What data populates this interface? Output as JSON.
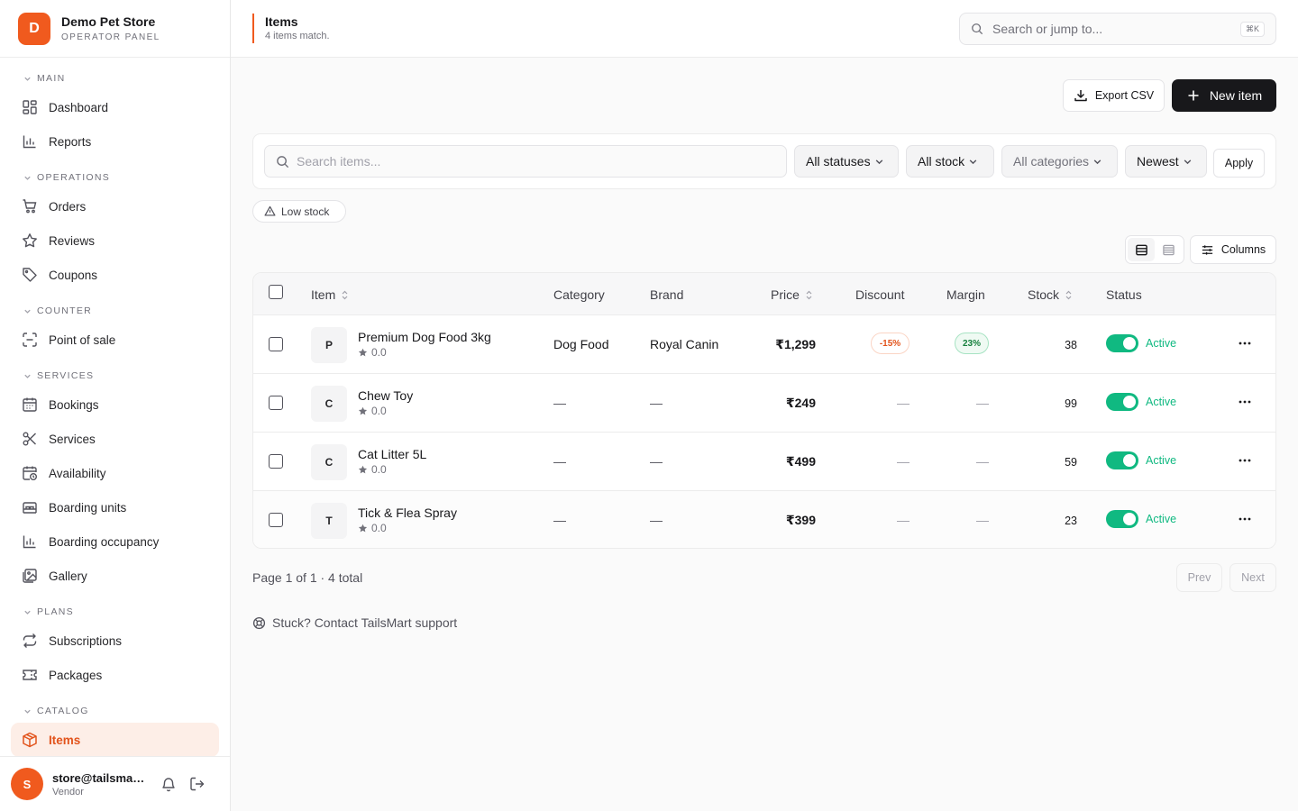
{
  "brand": {
    "initial": "D",
    "name": "Demo Pet Store",
    "subtitle": "OPERATOR PANEL"
  },
  "sidebar": {
    "sections": [
      {
        "title": "MAIN",
        "items": [
          {
            "label": "Dashboard",
            "icon": "grid-icon"
          },
          {
            "label": "Reports",
            "icon": "bar-chart-icon"
          }
        ]
      },
      {
        "title": "OPERATIONS",
        "items": [
          {
            "label": "Orders",
            "icon": "cart-icon"
          },
          {
            "label": "Reviews",
            "icon": "star-icon"
          },
          {
            "label": "Coupons",
            "icon": "tag-icon"
          }
        ]
      },
      {
        "title": "COUNTER",
        "items": [
          {
            "label": "Point of sale",
            "icon": "scan-icon"
          }
        ]
      },
      {
        "title": "SERVICES",
        "items": [
          {
            "label": "Bookings",
            "icon": "calendar-icon"
          },
          {
            "label": "Services",
            "icon": "scissors-icon"
          },
          {
            "label": "Availability",
            "icon": "calendar-clock-icon"
          },
          {
            "label": "Boarding units",
            "icon": "bed-icon"
          },
          {
            "label": "Boarding occupancy",
            "icon": "bar-chart-icon"
          },
          {
            "label": "Gallery",
            "icon": "image-icon"
          }
        ]
      },
      {
        "title": "PLANS",
        "items": [
          {
            "label": "Subscriptions",
            "icon": "repeat-icon"
          },
          {
            "label": "Packages",
            "icon": "ticket-icon"
          }
        ]
      },
      {
        "title": "CATALOG",
        "items": [
          {
            "label": "Items",
            "icon": "box-icon",
            "active": true
          }
        ]
      }
    ]
  },
  "user": {
    "initial": "S",
    "email": "store@tailsmart.in",
    "role": "Vendor"
  },
  "header": {
    "title": "Items",
    "subtitle": "4 items match.",
    "search_placeholder": "Search or jump to...",
    "shortcut": "⌘K"
  },
  "toolbar": {
    "export_label": "Export CSV",
    "new_label": "New item"
  },
  "filters": {
    "search_placeholder": "Search items...",
    "status": "All statuses",
    "stock": "All stock",
    "category": "All categories",
    "sort": "Newest",
    "apply_label": "Apply",
    "chip_label": "Low stock"
  },
  "view": {
    "columns_label": "Columns"
  },
  "table": {
    "headers": {
      "item": "Item",
      "category": "Category",
      "brand": "Brand",
      "price": "Price",
      "discount": "Discount",
      "margin": "Margin",
      "stock": "Stock",
      "status": "Status"
    },
    "rows": [
      {
        "initial": "P",
        "name": "Premium Dog Food 3kg",
        "rating": "0.0",
        "category": "Dog Food",
        "brand": "Royal Canin",
        "price": "₹1,299",
        "discount": "-15%",
        "margin": "23%",
        "stock": "38",
        "status": "Active"
      },
      {
        "initial": "C",
        "name": "Chew Toy",
        "rating": "0.0",
        "category": "—",
        "brand": "—",
        "price": "₹249",
        "discount": "—",
        "margin": "—",
        "stock": "99",
        "status": "Active"
      },
      {
        "initial": "C",
        "name": "Cat Litter 5L",
        "rating": "0.0",
        "category": "—",
        "brand": "—",
        "price": "₹499",
        "discount": "—",
        "margin": "—",
        "stock": "59",
        "status": "Active"
      },
      {
        "initial": "T",
        "name": "Tick & Flea Spray",
        "rating": "0.0",
        "category": "—",
        "brand": "—",
        "price": "₹399",
        "discount": "—",
        "margin": "—",
        "stock": "23",
        "status": "Active"
      }
    ]
  },
  "pagination": {
    "summary": "Page 1 of 1 · 4 total",
    "prev_label": "Prev",
    "next_label": "Next"
  },
  "support": {
    "text": "Stuck? Contact TailsMart support"
  },
  "colors": {
    "accent": "#f05a1e",
    "active_green": "#10b981",
    "primary_dark": "#18181b"
  }
}
